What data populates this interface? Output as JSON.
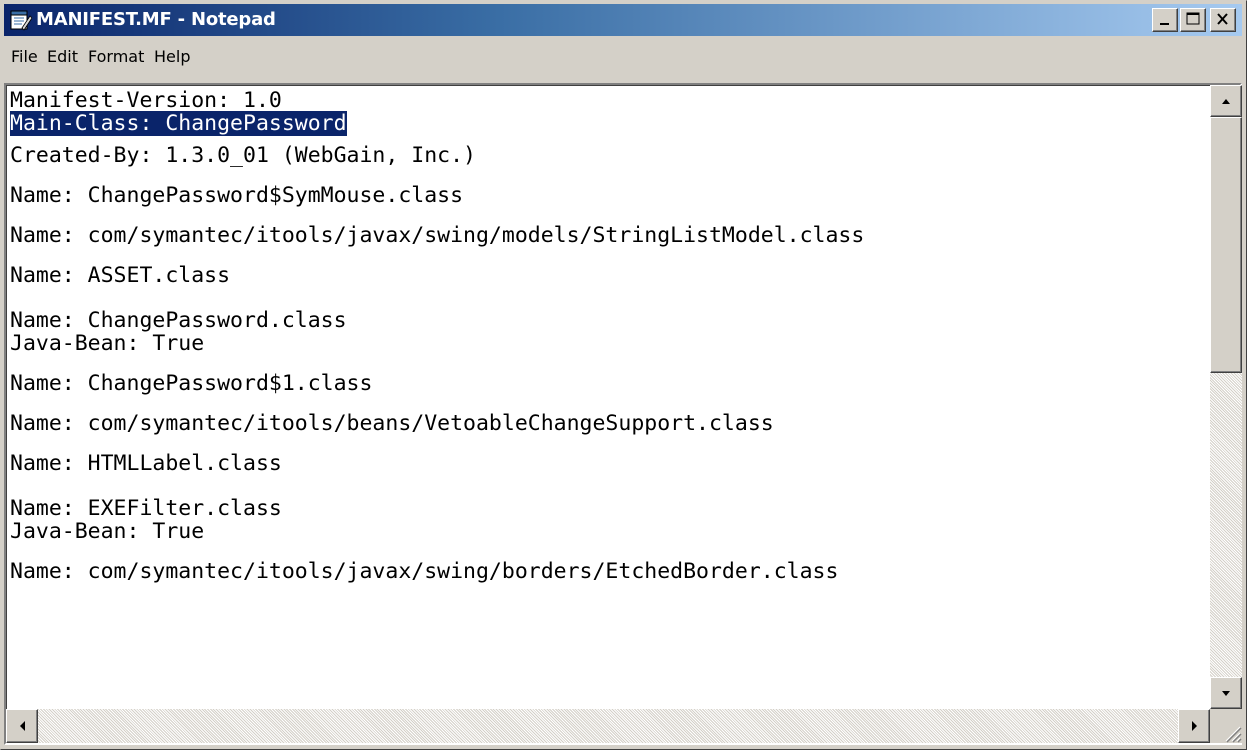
{
  "window": {
    "title": "MANIFEST.MF - Notepad",
    "icons": {
      "app": "notepad-icon",
      "minimize": "minimize-icon",
      "maximize": "maximize-icon",
      "close": "close-icon"
    }
  },
  "menu": {
    "file": "File",
    "edit": "Edit",
    "format": "Format",
    "help": "Help"
  },
  "document": {
    "lines": [
      "Manifest-Version: 1.0",
      "Main-Class: ChangePassword",
      "Created-By: 1.3.0_01 (WebGain, Inc.)",
      "",
      "Name: ChangePassword$SymMouse.class",
      "",
      "Name: com/symantec/itools/javax/swing/models/StringListModel.class",
      "",
      "Name: ASSET.class",
      "",
      "Name: ChangePassword.class",
      "Java-Bean: True",
      "",
      "Name: ChangePassword$1.class",
      "",
      "Name: com/symantec/itools/beans/VetoableChangeSupport.class",
      "",
      "Name: HTMLLabel.class",
      "",
      "Name: EXEFilter.class",
      "Java-Bean: True",
      "",
      "Name: com/symantec/itools/javax/swing/borders/EtchedBorder.class"
    ],
    "selected_line_index": 1,
    "selected_text": "Main-Class: ChangePassword"
  },
  "colors": {
    "title_active": "#0a246a",
    "selection": "#0a246a",
    "chrome": "#d4d0c8"
  }
}
